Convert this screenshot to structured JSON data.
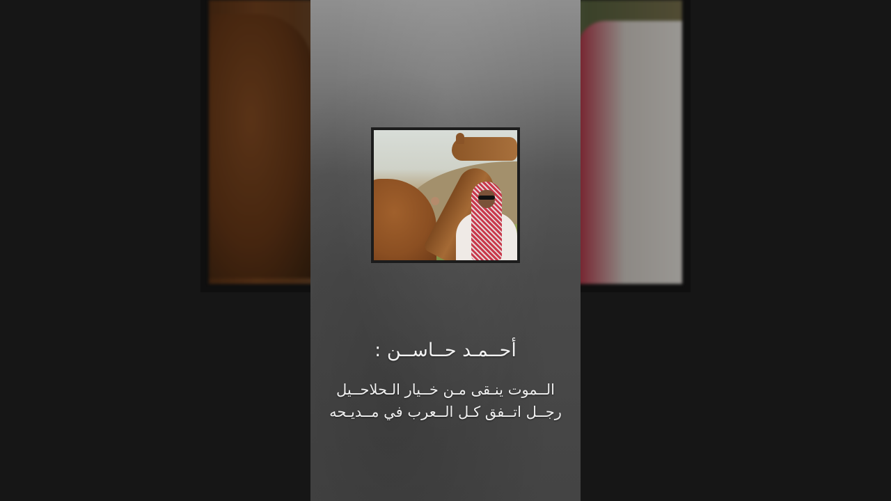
{
  "poem": {
    "name": "أحــمـد حــاســن :",
    "lines": [
      "الــموت ينـقى مـن خــيار الـحلاحــيل",
      "رجــل اتــفق كـل الــعرب في مــديـحه"
    ]
  },
  "colors": {
    "background": "#161616",
    "panel": "#4a4a4a",
    "text": "#f2f2f2"
  }
}
